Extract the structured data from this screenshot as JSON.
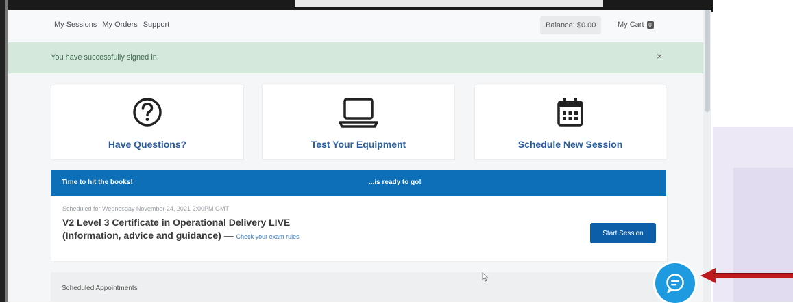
{
  "nav": {
    "links": [
      "My Sessions",
      "My Orders",
      "Support"
    ],
    "balance": "Balance: $0.00",
    "cart_label": "My Cart",
    "cart_count": "0"
  },
  "alert": {
    "message": "You have successfully signed in.",
    "close": "×"
  },
  "cards": [
    {
      "label": "Have Questions?",
      "icon": "question-circle-icon"
    },
    {
      "label": "Test Your Equipment",
      "icon": "laptop-icon"
    },
    {
      "label": "Schedule New Session",
      "icon": "calendar-icon"
    }
  ],
  "banner": {
    "left_text": "Time to hit the books!",
    "right_text": "...is ready to go!"
  },
  "session": {
    "scheduled_for": "Scheduled for Wednesday November 24, 2021 2:00PM GMT",
    "title_line1": "V2 Level 3 Certificate in Operational Delivery LIVE",
    "title_line2": "(Information, advice and guidance)",
    "dash": "—",
    "rules_link": "Check your exam rules",
    "start_button": "Start Session"
  },
  "appointments": {
    "label": "Scheduled Appointments"
  },
  "colors": {
    "accent": "#0c6fb8",
    "button": "#0c5ea8",
    "alert_bg": "#d4e9dc",
    "chat": "#1e9be0",
    "arrow": "#c0181f"
  }
}
